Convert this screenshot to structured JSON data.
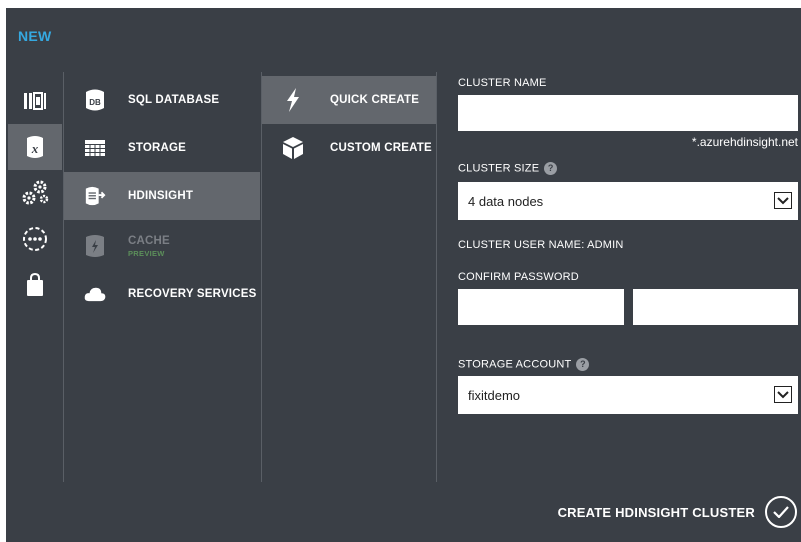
{
  "header": {
    "title": "NEW"
  },
  "strip": {
    "icons": [
      "compute-grid-icon",
      "data-services-icon",
      "app-services-icon",
      "network-services-icon",
      "store-icon"
    ],
    "selected_index": 1
  },
  "categories": [
    {
      "label": "SQL DATABASE",
      "icon": "database-icon"
    },
    {
      "label": "STORAGE",
      "icon": "table-storage-icon"
    },
    {
      "label": "HDINSIGHT",
      "icon": "hdinsight-icon"
    },
    {
      "label": "CACHE",
      "sub": "PREVIEW",
      "icon": "cache-icon"
    },
    {
      "label": "RECOVERY SERVICES",
      "icon": "cloud-icon"
    }
  ],
  "create_options": [
    {
      "label": "QUICK CREATE",
      "icon": "lightning-icon"
    },
    {
      "label": "CUSTOM CREATE",
      "icon": "box-icon"
    }
  ],
  "form": {
    "cluster_name": {
      "label": "CLUSTER NAME",
      "value": "",
      "suffix": "*.azurehdinsight.net"
    },
    "cluster_size": {
      "label": "CLUSTER SIZE",
      "value": "4 data nodes"
    },
    "cluster_user": {
      "label": "CLUSTER USER NAME: ADMIN"
    },
    "confirm_password": {
      "label": "CONFIRM PASSWORD"
    },
    "storage_account": {
      "label": "STORAGE ACCOUNT",
      "value": "fixitdemo"
    },
    "help_glyph": "?"
  },
  "footer": {
    "create_label": "CREATE HDINSIGHT CLUSTER"
  },
  "colors": {
    "panel": "#3a3f46",
    "selected": "#63676d",
    "accent": "#35a8e0",
    "preview": "#5c8f5a"
  }
}
